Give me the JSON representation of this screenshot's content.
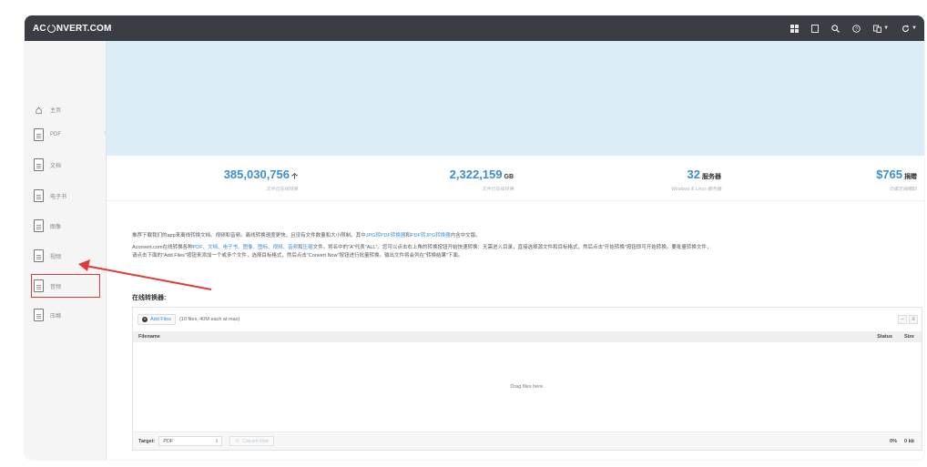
{
  "header": {
    "logo_left": "AC",
    "logo_right": "NVERT.COM",
    "icons": [
      "grid-icon",
      "square-icon",
      "search-icon",
      "help-icon",
      "language-icon",
      "refresh-icon"
    ]
  },
  "sidebar": {
    "items": [
      {
        "label": "主页",
        "icon": "home-icon"
      },
      {
        "label": "PDF",
        "icon": "pdf-icon"
      },
      {
        "label": "文档",
        "icon": "document-icon"
      },
      {
        "label": "电子书",
        "icon": "ebook-icon"
      },
      {
        "label": "图像",
        "icon": "image-icon"
      },
      {
        "label": "视频",
        "icon": "video-icon"
      },
      {
        "label": "音频",
        "icon": "audio-icon"
      },
      {
        "label": "压缩",
        "icon": "archive-icon"
      }
    ],
    "active_index": 6
  },
  "stats": [
    {
      "value": "385,030,756",
      "unit": "个",
      "sub": "文件已在线转换"
    },
    {
      "value": "2,322,159",
      "unit": "GB",
      "sub": "文件已在线转换"
    },
    {
      "value": "32",
      "unit": "服务器",
      "sub": "Windows & Linux 服务器"
    },
    {
      "value": "$765",
      "unit": "捐赠",
      "sub": "仍需还捐赠$5"
    }
  ],
  "description": {
    "line1_a": "推荐下载我们的app来离线转换文档、视频和音频。离线转换速度更快，且没有文件数量和大小限制。其中",
    "line1_link1": "JPG转PDF转换器",
    "line1_b": "和",
    "line1_link2": "PDF转JPG转换器",
    "line1_c": "内含中文版。",
    "line2_a": "Aconvert.com在线转换各种",
    "line2_links": "PDF、文档、电子书、图像、图标、视频、音频",
    "line2_b": "和",
    "line2_link3": "压缩",
    "line2_c": "文件。将名中的\"A\"代表\"ALL\"。您可以点击右上角的转换按钮开始快速转换：无需进入目录，直接选择源文件和目标格式，然后点击\"开始转换\"按钮即可开始转换。要批量转换文件，",
    "line3": "请点击下面的\"Add Files\"按钮来添加一个或多个文件，选择目标格式，然后点击\"Convert Now\"按钮进行批量转换。输出文件将会列在\"转换结果\"下面。"
  },
  "converter": {
    "title": "在线转换器:",
    "add_files": "Add Files",
    "limit": "(10 files, 40M each at max)",
    "col_filename": "Filename",
    "col_status": "Status",
    "col_size": "Size",
    "drop_text": "Drag files here.",
    "target_label": "Target:",
    "target_value": "PDF",
    "convert_now": "Convert Now",
    "progress": "0%",
    "total_size": "0 kb"
  },
  "colors": {
    "topbar": "#3a3e44",
    "banner": "#dbeef8",
    "accent": "#3a8fd0",
    "highlight": "#e03a3a"
  }
}
